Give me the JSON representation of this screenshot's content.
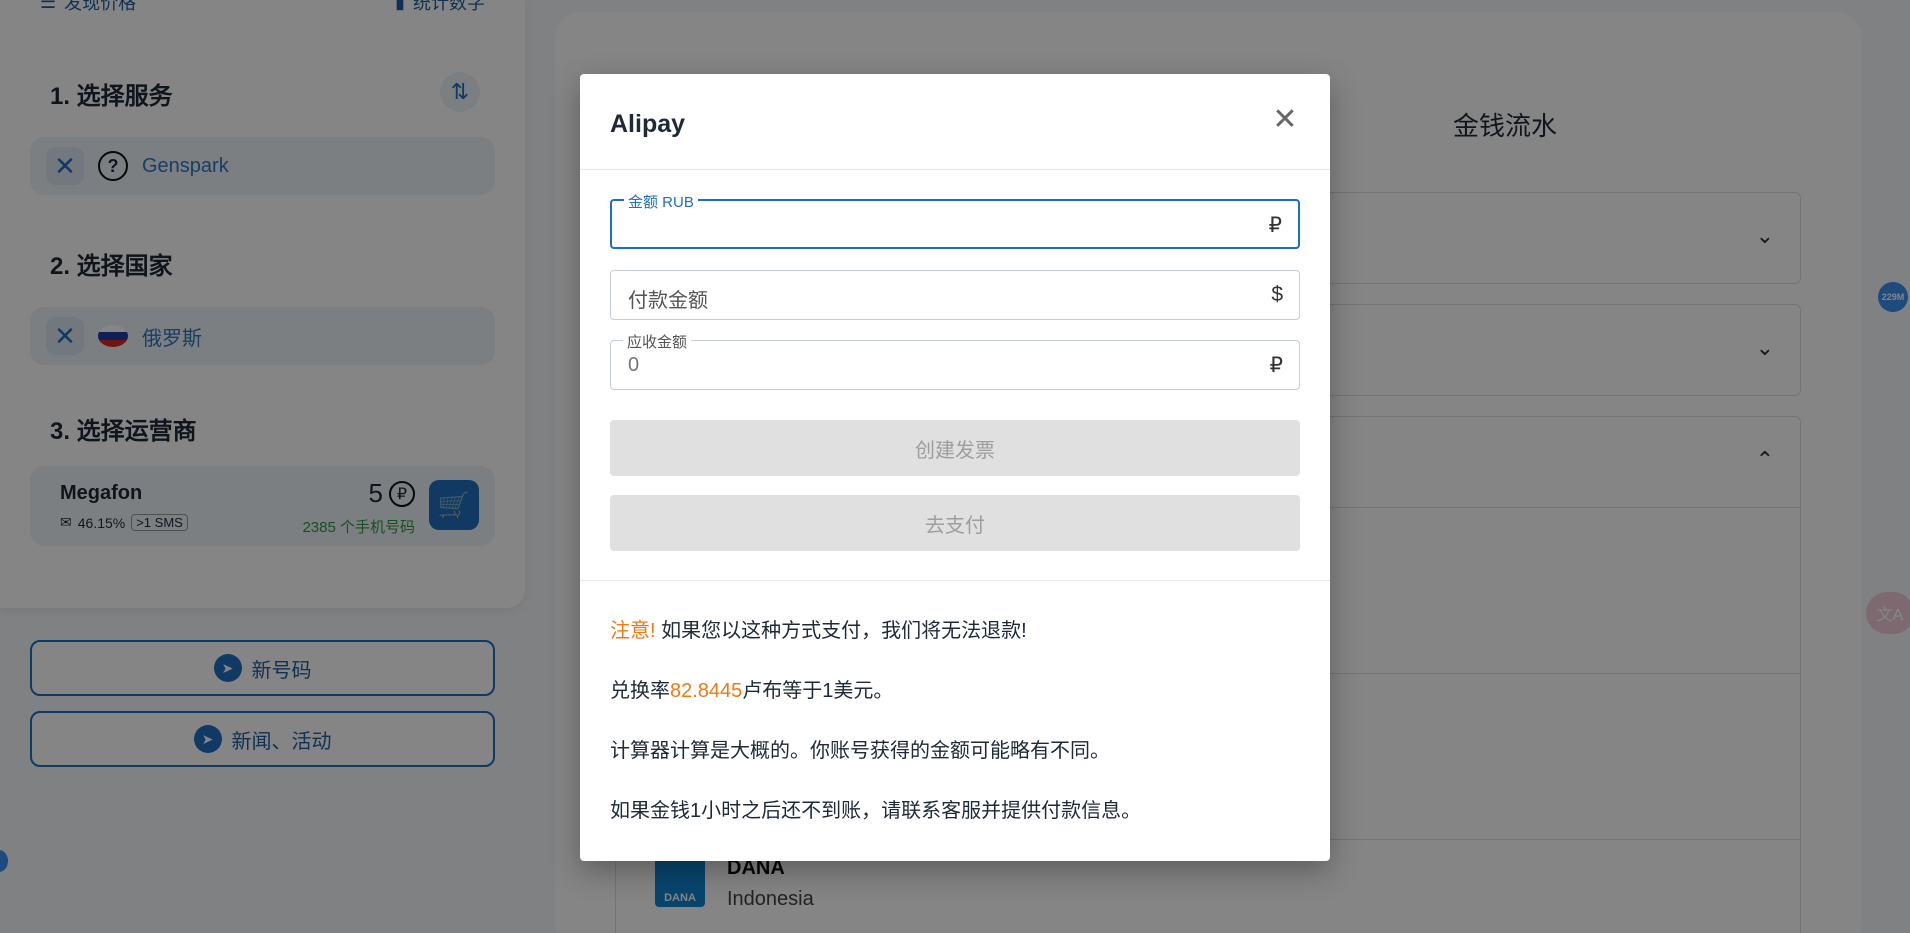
{
  "sidebar": {
    "top_left": "发现价格",
    "top_right": "统计数字",
    "section1": "1. 选择服务",
    "service": "Genspark",
    "section2": "2. 选择国家",
    "country": "俄罗斯",
    "section3": "3. 选择运营商",
    "operator": {
      "name": "Megafon",
      "rate": "46.15%",
      "badge": ">1 SMS",
      "price": "5",
      "currency_symbol": "₽",
      "count": "2385 个手机号码"
    },
    "btn_new_number": "新号码",
    "btn_news": "新闻、活动"
  },
  "right_panel": {
    "title": "金钱流水",
    "dana_name": "DANA",
    "dana_country": "Indonesia",
    "badge_mem": "229M"
  },
  "modal": {
    "title": "Alipay",
    "field_amount_label": "金额 RUB",
    "field_amount_unit": "₽",
    "field_pay_placeholder": "付款金额",
    "field_pay_unit": "$",
    "field_receive_label": "应收金额",
    "field_receive_value": "0",
    "field_receive_unit": "₽",
    "btn_create": "创建发票",
    "btn_pay": "去支付",
    "note_warning_prefix": "注意!",
    "note_warning_text": " 如果您以这种方式支付，我们将无法退款!",
    "note_rate_prefix": "兑换率",
    "note_rate_value": "82.8445",
    "note_rate_suffix": "卢布等于1美元。",
    "note_calc": "计算器计算是大概的。你账号获得的金额可能略有不同。",
    "note_contact": "如果金钱1小时之后还不到账，请联系客服并提供付款信息。"
  },
  "colors": {
    "accent": "#1f6fbf",
    "warning": "#f07a12",
    "success": "#2c9a3a"
  }
}
